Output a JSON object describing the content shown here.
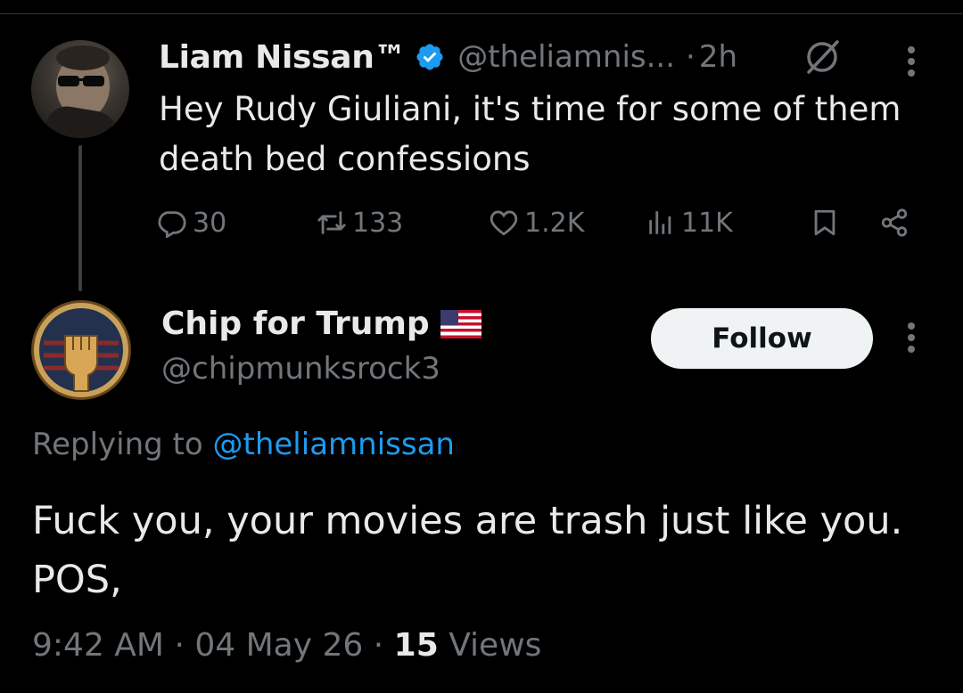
{
  "parent_tweet": {
    "display_name": "Liam Nissan™",
    "handle": "@theliamnis...",
    "separator": "·",
    "time_ago": "2h",
    "text": "Hey Rudy Giuliani, it's time for some of them death bed confessions",
    "stats": {
      "replies": "30",
      "reposts": "133",
      "likes": "1.2K",
      "views": "11K"
    }
  },
  "reply_tweet": {
    "display_name": "Chip for Trump",
    "handle": "@chipmunksrock3",
    "follow_label": "Follow",
    "replying_prefix": "Replying to",
    "replying_handle": "@theliamnissan",
    "text": "Fuck you, your movies are trash just like you. POS,",
    "time": "9:42 AM",
    "date": "04 May 26",
    "views_count": "15",
    "views_label": "Views"
  },
  "colors": {
    "background": "#000000",
    "primary_text": "#e7e9ea",
    "secondary_text": "#71767b",
    "link_blue": "#1d9bf0",
    "follow_button_bg": "#eff3f4"
  },
  "icons": [
    "verified-badge-icon",
    "grok-icon",
    "more-icon",
    "reply-icon",
    "repost-icon",
    "like-icon",
    "views-icon",
    "bookmark-icon",
    "share-icon",
    "us-flag-icon"
  ]
}
